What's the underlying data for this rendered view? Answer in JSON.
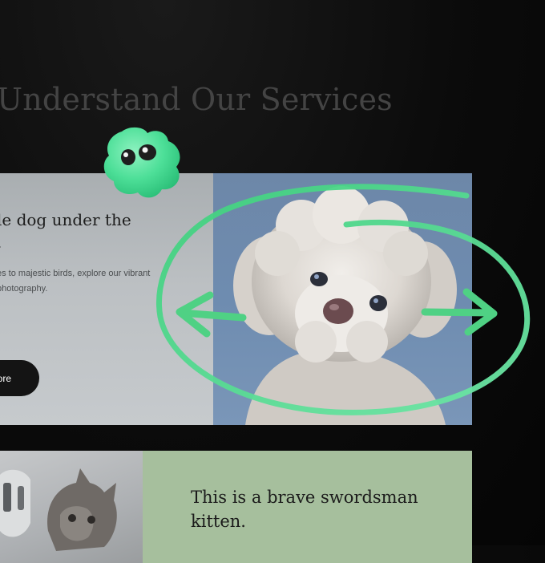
{
  "header": {
    "title": "Understand Our Services"
  },
  "card_dog": {
    "title_lines": [
      "le dog under the",
      "."
    ],
    "description_lines": [
      "es to majestic birds, explore our vibrant",
      "photography."
    ],
    "button_label": "ore"
  },
  "card_kitten": {
    "title_lines": [
      "This is a brave swordsman",
      "kitten."
    ]
  },
  "colors": {
    "background": "#0b0b0b",
    "accent_green": "#4fd184",
    "mascot_green": "#52e0a0",
    "card_green": "#a6bf9d",
    "button_dark": "#141414"
  },
  "icons": {
    "mascot": "green-blob-mascot",
    "left_arrow": "arrow-left-icon",
    "right_arrow": "arrow-right-icon"
  }
}
